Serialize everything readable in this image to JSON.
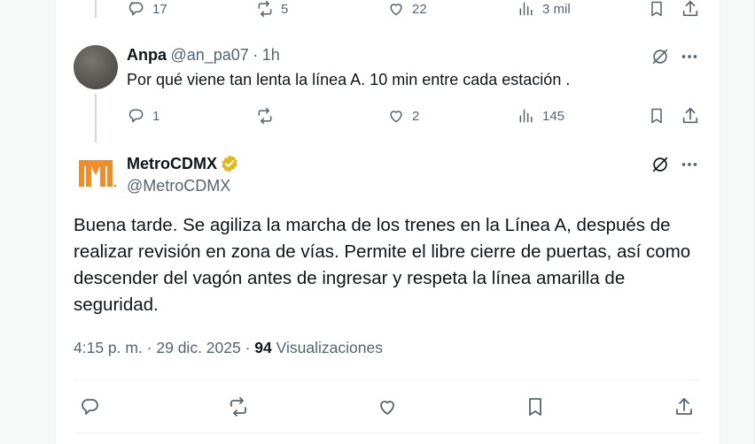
{
  "previous_actions": {
    "replies": "17",
    "reposts": "5",
    "likes": "22",
    "views": "3 mil"
  },
  "reply": {
    "name": "Anpa",
    "handle": "@an_pa07",
    "separator": "·",
    "time": "1h",
    "text": "Por qué viene tan lenta la línea A. 10 min entre cada estación .",
    "replies": "1",
    "likes": "2",
    "views": "145"
  },
  "main": {
    "name": "MetroCDMX",
    "handle": "@MetroCDMX",
    "text": "Buena tarde. Se agiliza la marcha de los trenes en la Línea A, después de realizar revisión en zona de vías. Permite el libre cierre de puertas, así como descender del vagón antes de ingresar y respeta la línea amarilla de seguridad.",
    "timestamp": "4:15 p. m. · 29 dic. 2025 ·",
    "views_count": "94",
    "views_label": "Visualizaciones"
  },
  "colors": {
    "metro_orange": "#f28c28",
    "verified_gold": "#e2b719",
    "text_primary": "#0f1419",
    "text_secondary": "#536471"
  },
  "icons": [
    "reply-icon",
    "repost-icon",
    "like-icon",
    "views-icon",
    "bookmark-icon",
    "share-icon",
    "grok-icon",
    "more-icon",
    "verified-badge-icon",
    "metro-logo"
  ]
}
